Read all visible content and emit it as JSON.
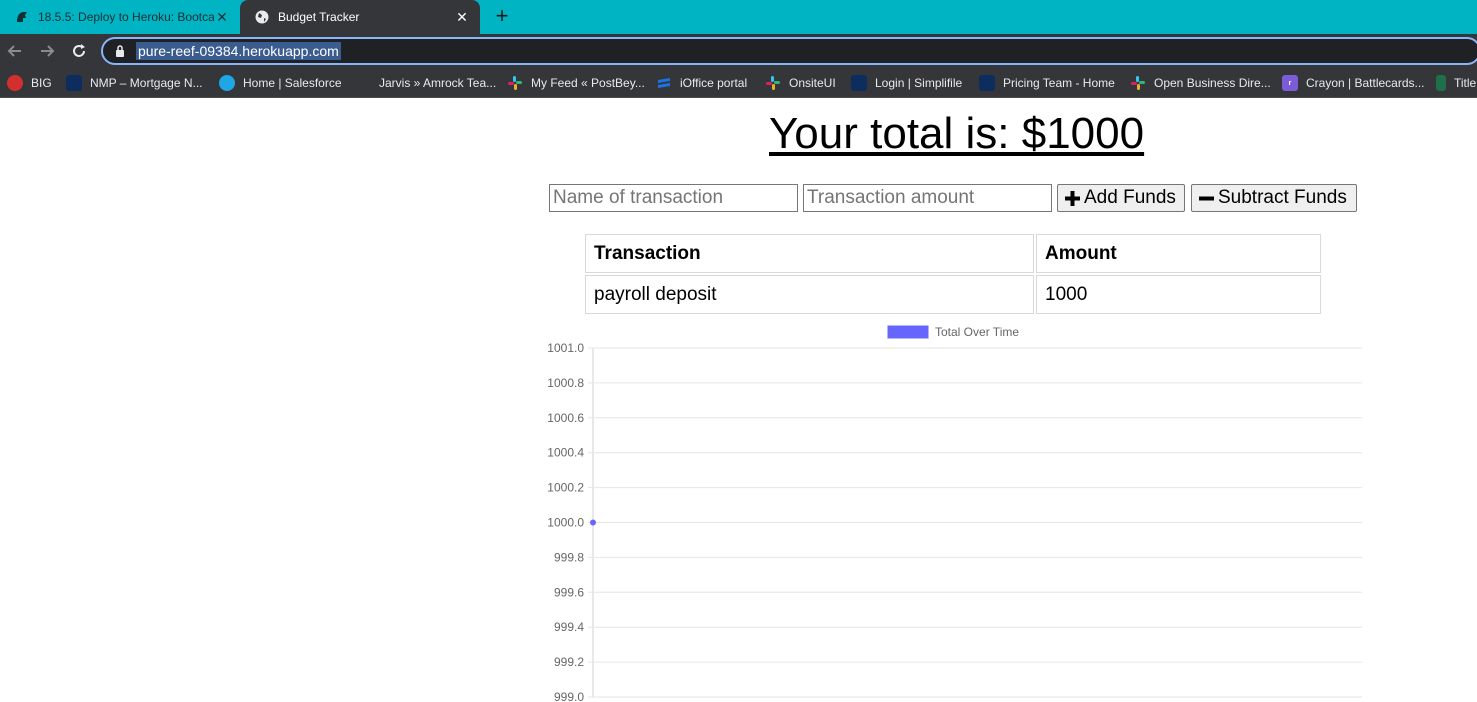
{
  "browser": {
    "tabs": [
      {
        "title": "18.5.5: Deploy to Heroku: Bootcamp",
        "active": false
      },
      {
        "title": "Budget Tracker",
        "active": true
      }
    ],
    "url": "pure-reef-09384.herokuapp.com",
    "bookmarks": [
      {
        "label": "BIG",
        "color": "#d32f2f"
      },
      {
        "label": "NMP – Mortgage N...",
        "color": "#0d2d5e"
      },
      {
        "label": "Home | Salesforce",
        "color": "#1ea7e2"
      },
      {
        "label": "Jarvis » Amrock Tea...",
        "color": "#35363a"
      },
      {
        "label": "My Feed « PostBey...",
        "color": "#e01e5a"
      },
      {
        "label": "iOffice portal",
        "color": "#1a73e8"
      },
      {
        "label": "OnsiteUI",
        "color": "#e01e5a"
      },
      {
        "label": "Login | Simplifile",
        "color": "#0d2d5e"
      },
      {
        "label": "Pricing Team - Home",
        "color": "#0d2d5e"
      },
      {
        "label": "Open Business Dire...",
        "color": "#e01e5a"
      },
      {
        "label": "Crayon | Battlecards...",
        "color": "#7c5cd6"
      },
      {
        "label": "Title",
        "color": "#1f6f4a"
      }
    ]
  },
  "app": {
    "total_text": "Your total is: $1000",
    "name_placeholder": "Name of transaction",
    "amount_placeholder": "Transaction amount",
    "add_label": "Add Funds",
    "subtract_label": "Subtract Funds",
    "table": {
      "headers": [
        "Transaction",
        "Amount"
      ],
      "rows": [
        [
          "payroll deposit",
          "1000"
        ]
      ]
    }
  },
  "chart_data": {
    "type": "line",
    "series": [
      {
        "name": "Total Over Time",
        "values": [
          1000
        ],
        "color": "#6666ff"
      }
    ],
    "ylim": [
      999.0,
      1001.0
    ],
    "yticks": [
      "1001.0",
      "1000.8",
      "1000.6",
      "1000.4",
      "1000.2",
      "1000.0",
      "999.8",
      "999.6",
      "999.4",
      "999.2",
      "999.0"
    ],
    "legend": "top-center",
    "grid": true
  }
}
